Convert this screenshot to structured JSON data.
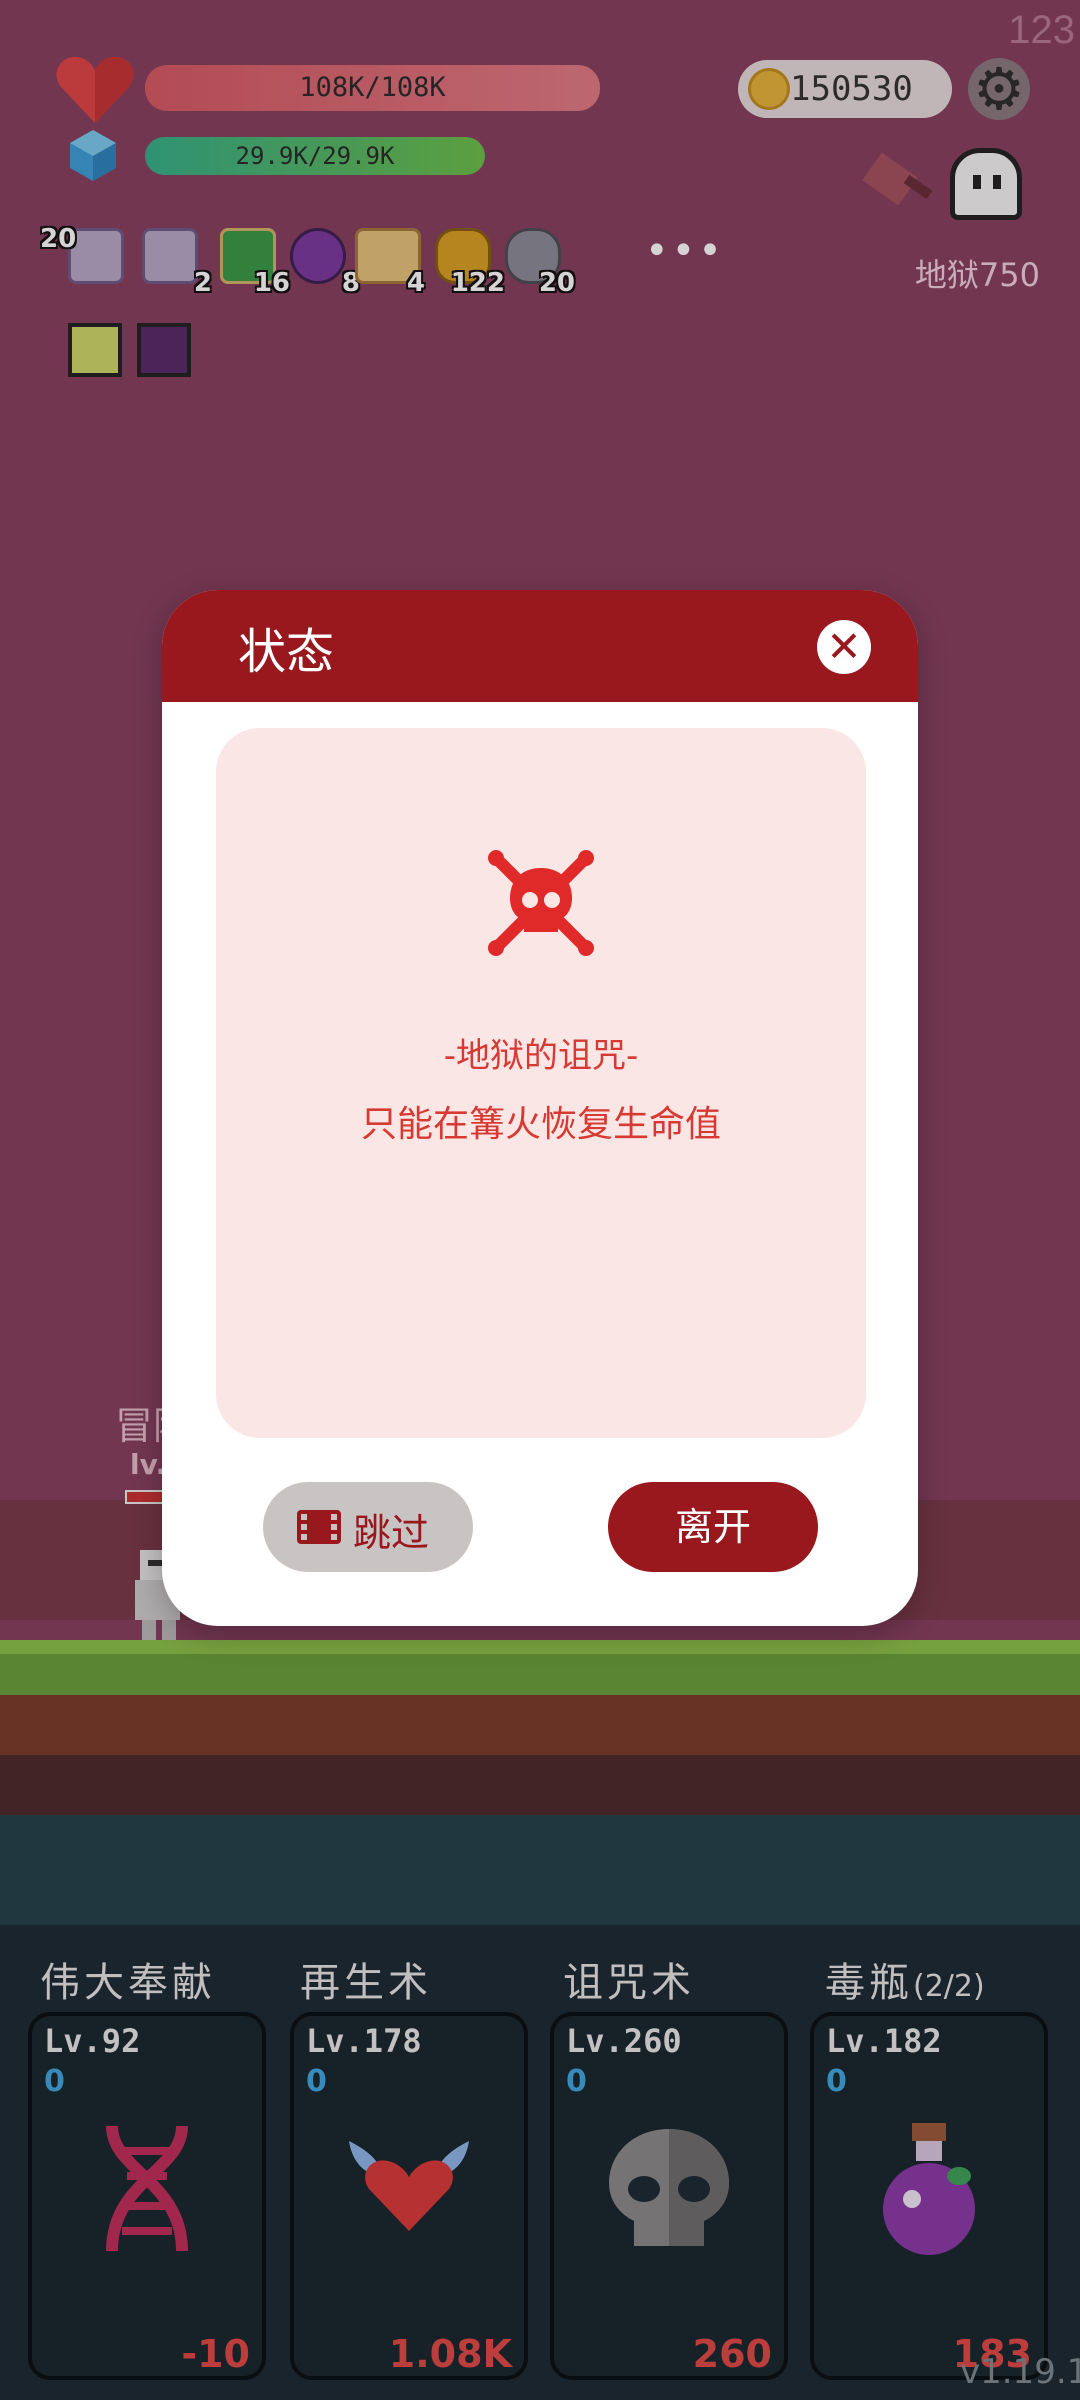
{
  "hud": {
    "hp": "108K/108K",
    "mp": "29.9K/29.9K",
    "coins": "150530",
    "corner_number": "123",
    "hell_level": "地狱750"
  },
  "inventory": [
    {
      "icon": "scroll-ribbon-icon",
      "count": "20",
      "color": "#b7a9c9"
    },
    {
      "icon": "scroll-ribbon-icon",
      "count": "2",
      "color": "#b7a9c9"
    },
    {
      "icon": "green-book-icon",
      "count": "16",
      "color": "#3a9a46"
    },
    {
      "icon": "purple-potion-icon",
      "count": "8",
      "color": "#7a3aa0"
    },
    {
      "icon": "treasure-map-icon",
      "count": "4",
      "color": "#d8a14a"
    },
    {
      "icon": "gold-coins-icon",
      "count": "122",
      "color": "#d8a024"
    },
    {
      "icon": "rocks-icon",
      "count": "20",
      "color": "#8c8c96"
    }
  ],
  "buffs": [
    {
      "icon": "light-buff-icon",
      "color": "#cfd86a"
    },
    {
      "icon": "shadow-buff-icon",
      "color": "#5a2a6a"
    }
  ],
  "character": {
    "name": "冒险",
    "level": "lv."
  },
  "dialog": {
    "title": "状态",
    "curse_title": "-地狱的诅咒-",
    "curse_desc": "只能在篝火恢复生命值",
    "skip": "跳过",
    "leave": "离开"
  },
  "skills": [
    {
      "name": "伟大奉献",
      "sub": "",
      "level": "Lv.92",
      "zero": "0",
      "value": "-10",
      "icon": "dna-icon"
    },
    {
      "name": "再生术",
      "sub": "",
      "level": "Lv.178",
      "zero": "0",
      "value": "1.08K",
      "icon": "winged-heart-icon"
    },
    {
      "name": "诅咒术",
      "sub": "",
      "level": "Lv.260",
      "zero": "0",
      "value": "260",
      "icon": "skull-icon"
    },
    {
      "name": "毒瓶",
      "sub": "(2/2)",
      "level": "Lv.182",
      "zero": "0",
      "value": "183",
      "icon": "poison-bottle-icon"
    }
  ],
  "version": "v1.19.1"
}
